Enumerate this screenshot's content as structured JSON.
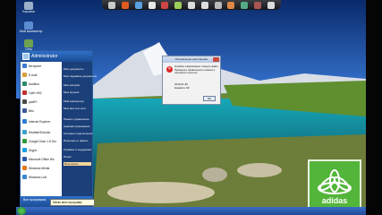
{
  "desktop_icons": [
    {
      "label": "Корзина",
      "color": "#9ab0c8",
      "icon": "recycle-bin-icon"
    },
    {
      "label": "Мой компьютер",
      "color": "#5b8bd0",
      "icon": "computer-icon"
    },
    {
      "label": "Сеть",
      "color": "#6fa04f",
      "icon": "network-icon"
    }
  ],
  "dock_colors": [
    "#c9c9c9",
    "#e05a22",
    "#5aa0e0",
    "#e8e8e8",
    "#c44",
    "#9ccf5a",
    "#ddd",
    "#ddd",
    "#bbb",
    "#d84",
    "#5a8",
    "#a55",
    "#ddd"
  ],
  "start_menu": {
    "user": "Administrator",
    "pinned": [
      {
        "label": "Интернет",
        "color": "#3a7ad0",
        "icon": "internet-icon"
      },
      {
        "label": "E-mail",
        "color": "#d8a040",
        "icon": "mail-icon"
      },
      {
        "label": "Audition",
        "color": "#2a8a6a",
        "icon": "audition-icon"
      },
      {
        "label": "Сайт ИК2",
        "color": "#c03030",
        "icon": "site-icon"
      },
      {
        "label": "qutePl",
        "color": "#4a4a4a",
        "icon": "app-icon"
      },
      {
        "label": "ВКо",
        "color": "#3b5998",
        "icon": "vk-icon"
      },
      {
        "label": "Internet Explorer",
        "color": "#2f7ad8",
        "icon": "ie-icon"
      },
      {
        "label": "RealtekHDAudio",
        "color": "#3aa0d0",
        "icon": "realtek-icon"
      },
      {
        "label": "Google Drive 1.8 Set",
        "color": "#2a9a3a",
        "icon": "drive-icon"
      },
      {
        "label": "Skype",
        "color": "#1aa0e0",
        "icon": "skype-icon"
      },
      {
        "label": "Microsoft Office Wo",
        "color": "#2a5aa8",
        "icon": "word-icon"
      },
      {
        "label": "Windows Media",
        "color": "#e07820",
        "icon": "media-icon"
      },
      {
        "label": "Windows Live",
        "color": "#3a88d0",
        "icon": "live-icon"
      }
    ],
    "right": [
      "Мои документы",
      "Мои недавние документы",
      "Мои рисунки",
      "Моя музыка",
      "Мой компьютер",
      "Мои места в сети",
      "Панель управления",
      "Администрирование",
      "Сетевые подключения",
      "Принтеры и факсы",
      "Справка и поддержка",
      "Поиск",
      "Выполнить"
    ],
    "all_programs": "Все программы",
    "tooltip": "Меню всех программ"
  },
  "dialog": {
    "title": "Обозначение расстановки",
    "message": "Ошибка: Невозможно открыть файл. Проверьте правильность имени и повторите попытку.",
    "date": "2016-01-30",
    "note": "Нажмите ОК",
    "ok": "OK"
  },
  "brand": {
    "word": "adidas",
    "color": "#53b53a"
  }
}
